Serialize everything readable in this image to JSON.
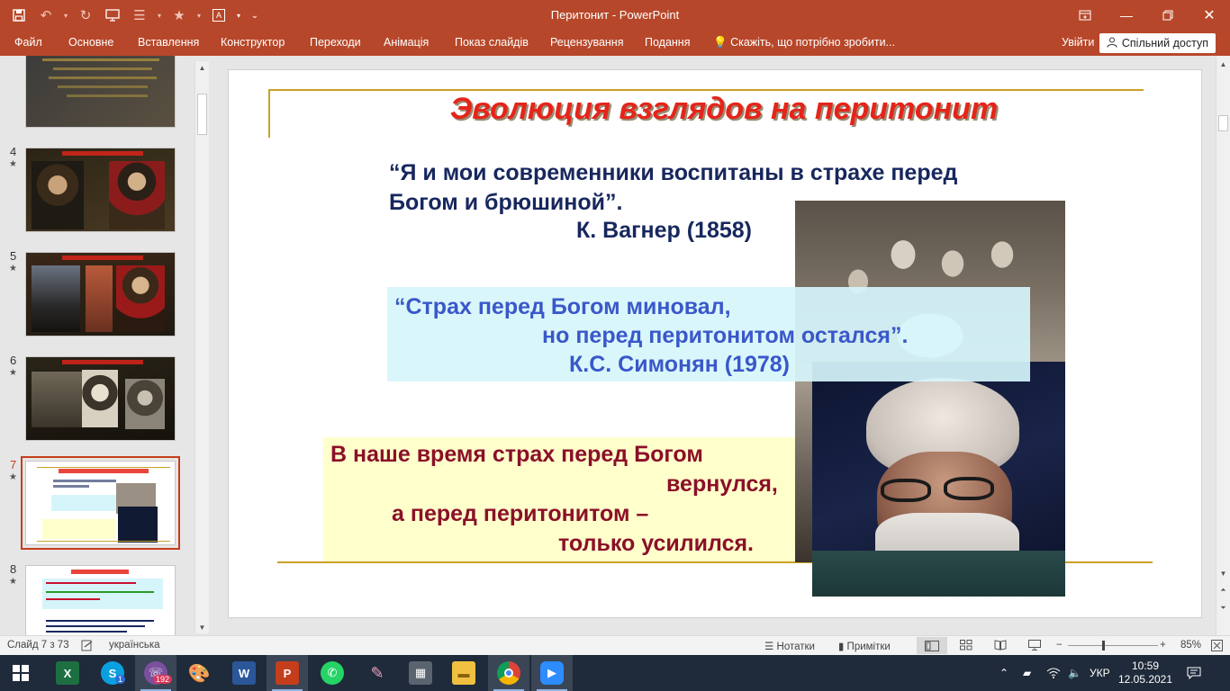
{
  "app": {
    "title": "Перитонит - PowerPoint",
    "sign_in": "Увійти",
    "share": "Спільний доступ",
    "accent": "#b7472a"
  },
  "menu": {
    "file": "Файл",
    "home": "Основне",
    "insert": "Вставлення",
    "design": "Конструктор",
    "transitions": "Переходи",
    "animations": "Анімація",
    "slideshow": "Показ слайдів",
    "review": "Рецензування",
    "view": "Подання",
    "tell_me": "Скажіть, що потрібно зробити..."
  },
  "thumbnails": [
    {
      "number": "4"
    },
    {
      "number": "5"
    },
    {
      "number": "6"
    },
    {
      "number": "7"
    },
    {
      "number": "8"
    }
  ],
  "slide": {
    "title": "Эволюция взглядов на перитонит",
    "quote1": "“Я и мои современники воспитаны в страхе перед Богом и брюшиной”.",
    "author1": "К. Вагнер (1858)",
    "quote2_line1": "“Страх перед Богом миновал,",
    "quote2_line2": "но перед перитонитом остался”.",
    "author2": "К.С. Симонян (1978)",
    "quote3_line1": "В наше время страх перед Богом",
    "quote3_line2": "вернулся,",
    "quote3_line3": "а перед перитонитом –",
    "quote3_line4": "только усилился."
  },
  "status": {
    "slide_counter": "Слайд 7 з 73",
    "language": "українська",
    "notes": "Нотатки",
    "comments": "Примітки",
    "zoom": "85%"
  },
  "taskbar": {
    "viber_badge": "192",
    "skype_badge": "1",
    "lang": "УКР",
    "time": "10:59",
    "date": "12.05.2021"
  },
  "colors": {
    "title_red": "#e5241a",
    "quote_navy": "#17275e",
    "quote_blue": "#3a58c9",
    "quote_maroon": "#8b1028",
    "cyan_box": "#d6f5fb",
    "yellow_box": "#ffffcc",
    "gold_rule": "#c9a227"
  }
}
